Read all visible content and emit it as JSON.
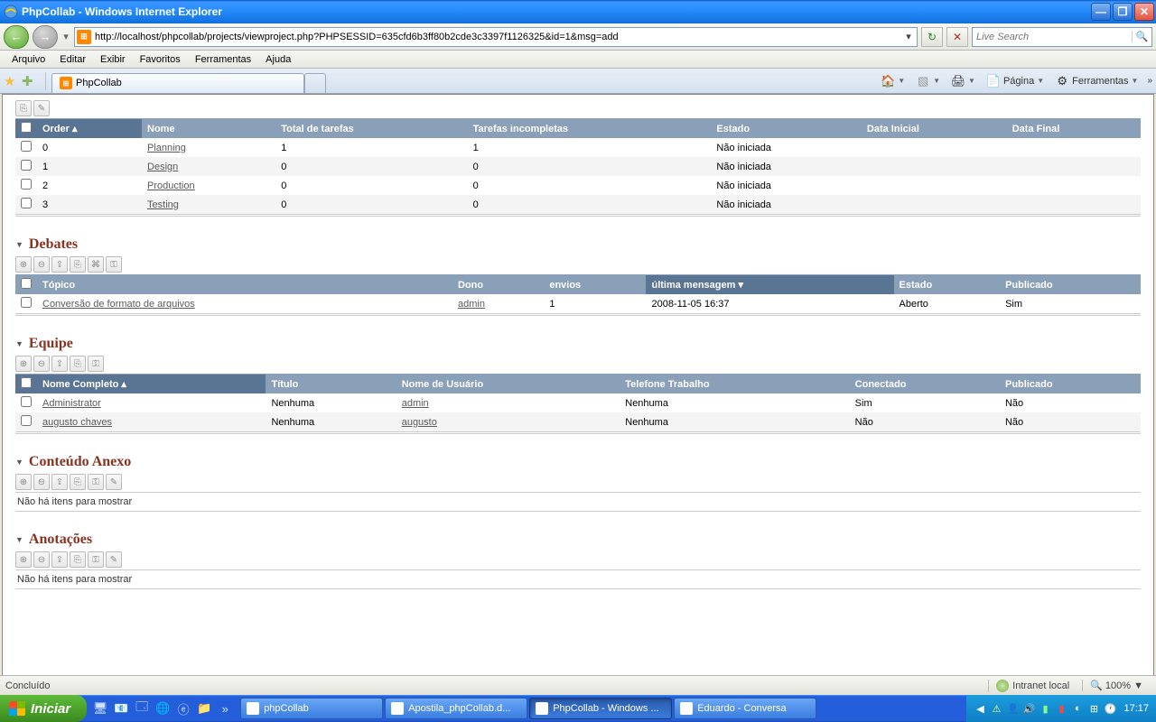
{
  "window": {
    "title": "PhpCollab - Windows Internet Explorer"
  },
  "nav": {
    "url": "http://localhost/phpcollab/projects/viewproject.php?PHPSESSID=635cfd6b3ff80b2cde3c3397f1126325&id=1&msg=add",
    "search_placeholder": "Live Search"
  },
  "menu": {
    "items": [
      "Arquivo",
      "Editar",
      "Exibir",
      "Favoritos",
      "Ferramentas",
      "Ajuda"
    ]
  },
  "tab": {
    "title": "PhpCollab"
  },
  "tools": {
    "pagina": "Página",
    "ferramentas": "Ferramentas"
  },
  "phases": {
    "headers": {
      "order": "Order",
      "nome": "Nome",
      "total": "Total de tarefas",
      "incompletas": "Tarefas incompletas",
      "estado": "Estado",
      "data_inicial": "Data Inicial",
      "data_final": "Data Final"
    },
    "rows": [
      {
        "order": "0",
        "nome": "Planning",
        "total": "1",
        "inc": "1",
        "estado": "Não iniciada"
      },
      {
        "order": "1",
        "nome": "Design",
        "total": "0",
        "inc": "0",
        "estado": "Não iniciada"
      },
      {
        "order": "2",
        "nome": "Production",
        "total": "0",
        "inc": "0",
        "estado": "Não iniciada"
      },
      {
        "order": "3",
        "nome": "Testing",
        "total": "0",
        "inc": "0",
        "estado": "Não iniciada"
      }
    ]
  },
  "debates": {
    "title": "Debates",
    "headers": {
      "topico": "Tópico",
      "dono": "Dono",
      "envios": "envios",
      "ultima": "última mensagem",
      "estado": "Estado",
      "publicado": "Publicado"
    },
    "rows": [
      {
        "topico": "Conversão de formato de arquivos",
        "dono": "admin",
        "envios": "1",
        "ultima": "2008-11-05 16:37",
        "estado": "Aberto",
        "publicado": "Sim"
      }
    ]
  },
  "equipe": {
    "title": "Equipe",
    "headers": {
      "nome": "Nome Completo",
      "titulo": "Título",
      "usuario": "Nome de Usuário",
      "telefone": "Telefone Trabalho",
      "conectado": "Conectado",
      "publicado": "Publicado"
    },
    "rows": [
      {
        "nome": "Administrator",
        "titulo": "Nenhuma",
        "usuario": "admin",
        "telefone": "Nenhuma",
        "conectado": "Sim",
        "publicado": "Não"
      },
      {
        "nome": "augusto chaves",
        "titulo": "Nenhuma",
        "usuario": "augusto",
        "telefone": "Nenhuma",
        "conectado": "Não",
        "publicado": "Não"
      }
    ]
  },
  "conteudo": {
    "title": "Conteúdo Anexo",
    "empty": "Não há itens para mostrar"
  },
  "anotacoes": {
    "title": "Anotações",
    "empty": "Não há itens para mostrar"
  },
  "status": {
    "left": "Concluído",
    "zone": "Intranet local",
    "zoom": "100%"
  },
  "taskbar": {
    "start": "Iniciar",
    "tasks": [
      {
        "label": "phpCollab"
      },
      {
        "label": "Apostila_phpCollab.d..."
      },
      {
        "label": "PhpCollab - Windows ...",
        "active": true
      },
      {
        "label": "Eduardo - Conversa"
      }
    ],
    "clock": "17:17"
  }
}
